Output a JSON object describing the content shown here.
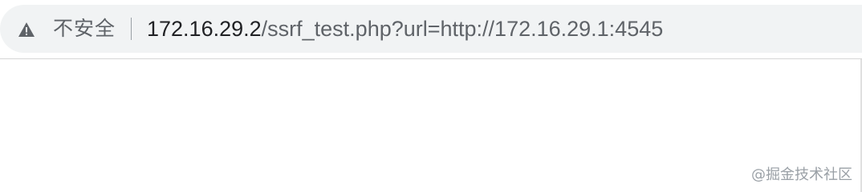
{
  "address_bar": {
    "security_icon": "warning-triangle-icon",
    "security_label": "不安全",
    "url_host": "172.16.29.2",
    "url_path": "/ssrf_test.php?url=http://172.16.29.1:4545"
  },
  "watermark": {
    "text": "@掘金技术社区"
  },
  "colors": {
    "omnibox_bg": "#f1f3f4",
    "host_text": "#202124",
    "secondary_text": "#5f6368"
  }
}
